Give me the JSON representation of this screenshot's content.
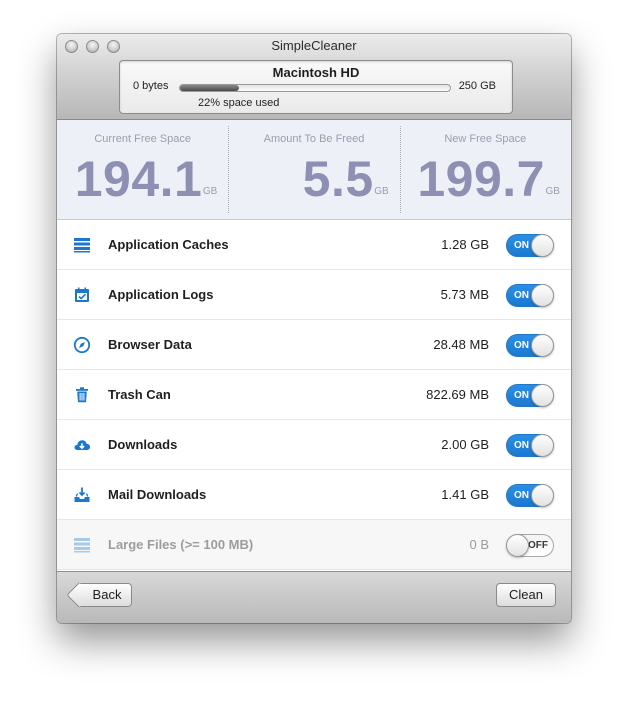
{
  "window": {
    "title": "SimpleCleaner"
  },
  "disk": {
    "name": "Macintosh HD",
    "min_label": "0 bytes",
    "max_label": "250 GB",
    "used_text": "22% space used",
    "used_fraction": 0.22
  },
  "stats": [
    {
      "label": "Current Free Space",
      "value": "194.1",
      "unit": "GB"
    },
    {
      "label": "Amount To Be Freed",
      "value": "5.5",
      "unit": "GB"
    },
    {
      "label": "New Free Space",
      "value": "199.7",
      "unit": "GB"
    }
  ],
  "items": [
    {
      "label": "Application Caches",
      "size": "1.28 GB",
      "toggle": "ON",
      "icon": "stack-icon"
    },
    {
      "label": "Application Logs",
      "size": "5.73 MB",
      "toggle": "ON",
      "icon": "calendar-check-icon"
    },
    {
      "label": "Browser Data",
      "size": "28.48 MB",
      "toggle": "ON",
      "icon": "compass-icon"
    },
    {
      "label": "Trash Can",
      "size": "822.69 MB",
      "toggle": "ON",
      "icon": "trash-icon"
    },
    {
      "label": "Downloads",
      "size": "2.00 GB",
      "toggle": "ON",
      "icon": "cloud-download-icon"
    },
    {
      "label": "Mail Downloads",
      "size": "1.41 GB",
      "toggle": "ON",
      "icon": "inbox-download-icon"
    },
    {
      "label": "Large Files (>= 100 MB)",
      "size": "0 B",
      "toggle": "OFF",
      "icon": "stack-icon"
    }
  ],
  "footer": {
    "back_label": "Back",
    "clean_label": "Clean"
  },
  "colors": {
    "accent": "#1b78d0",
    "stat_number": "#8e90b3",
    "stats_bg": "#eef0f8"
  }
}
